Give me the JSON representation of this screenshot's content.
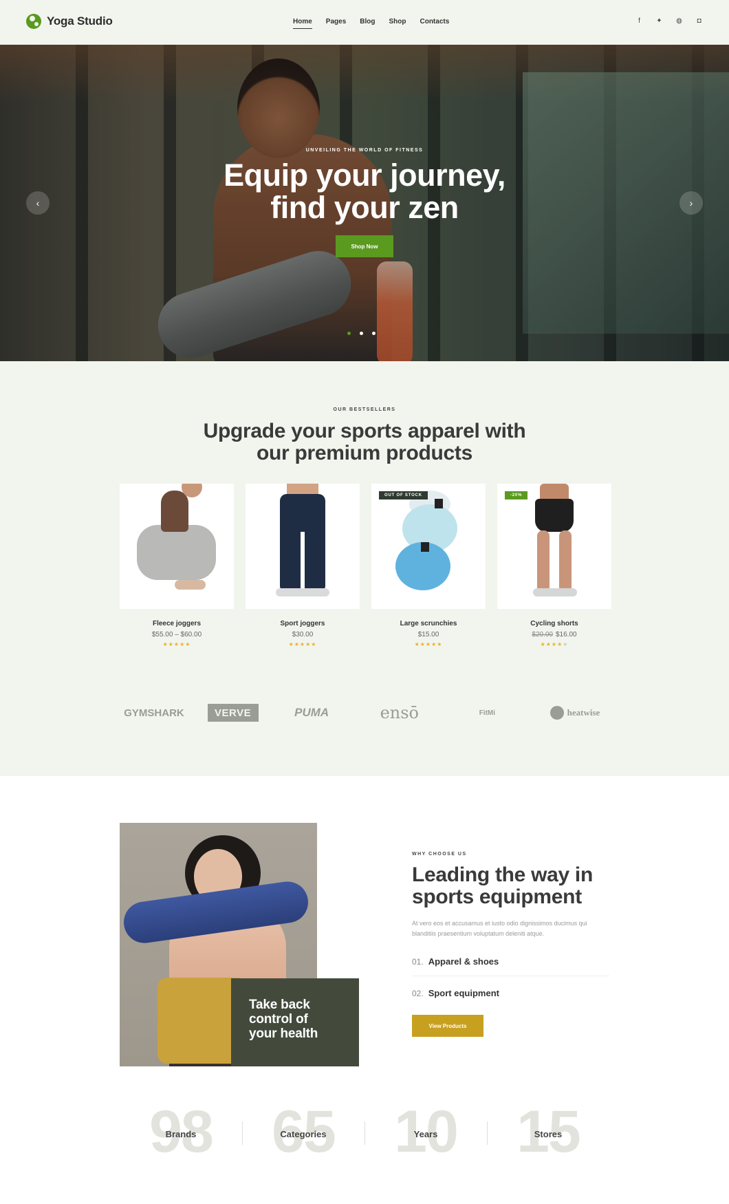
{
  "brand": {
    "name": "Yoga Studio",
    "accent": "#5a9a1f",
    "gold": "#c7a01f",
    "dark_card": "#434a3c"
  },
  "nav": [
    {
      "label": "Home",
      "active": true
    },
    {
      "label": "Pages",
      "active": false
    },
    {
      "label": "Blog",
      "active": false
    },
    {
      "label": "Shop",
      "active": false
    },
    {
      "label": "Contacts",
      "active": false
    }
  ],
  "social": [
    {
      "icon": "facebook-icon",
      "glyph": "f"
    },
    {
      "icon": "twitter-icon",
      "glyph": "✦"
    },
    {
      "icon": "dribbble-icon",
      "glyph": "◍"
    },
    {
      "icon": "instagram-icon",
      "glyph": "◘"
    }
  ],
  "hero": {
    "eyebrow": "UNVEILING THE WORLD OF FITNESS",
    "title_line1": "Equip your journey,",
    "title_line2": "find your zen",
    "button": "Shop Now",
    "prev_glyph": "‹",
    "next_glyph": "›",
    "slides_total": 3,
    "active_slide": 1
  },
  "bestsellers": {
    "eyebrow": "OUR BESTSELLERS",
    "title_line1": "Upgrade your sports apparel with",
    "title_line2": "our premium products",
    "products": [
      {
        "name": "Fleece joggers",
        "price": "$55.00 – $60.00",
        "old_price": "",
        "rating": 5,
        "badge": ""
      },
      {
        "name": "Sport joggers",
        "price": "$30.00",
        "old_price": "",
        "rating": 5,
        "badge": ""
      },
      {
        "name": "Large scrunchies",
        "price": "$15.00",
        "old_price": "",
        "rating": 5,
        "badge": "OUT OF STOCK"
      },
      {
        "name": "Cycling shorts",
        "price": "$16.00",
        "old_price": "$20.00",
        "rating": 4,
        "badge": "-20%"
      }
    ]
  },
  "brands": [
    {
      "label": "GYMSHARK"
    },
    {
      "label": "VERVE"
    },
    {
      "label": "PUMA"
    },
    {
      "label": "ensō"
    },
    {
      "label": "FitMi"
    },
    {
      "label": "heatwise"
    }
  ],
  "why": {
    "eyebrow": "WHY CHOOSE US",
    "title_line1": "Leading the way in",
    "title_line2": "sports equipment",
    "description": "At vero eos et accusamus et iusto odio dignissimos ducimus qui blanditiis praesentium voluptatum deleniti atque.",
    "items": [
      {
        "num": "01.",
        "label": "Apparel & shoes"
      },
      {
        "num": "02.",
        "label": "Sport equipment"
      }
    ],
    "button": "View Products",
    "card_line1": "Take back",
    "card_line2": "control of",
    "card_line3": "your health"
  },
  "stats": [
    {
      "value": "98",
      "label": "Brands"
    },
    {
      "value": "65",
      "label": "Categories"
    },
    {
      "value": "10",
      "label": "Years"
    },
    {
      "value": "15",
      "label": "Stores"
    }
  ]
}
